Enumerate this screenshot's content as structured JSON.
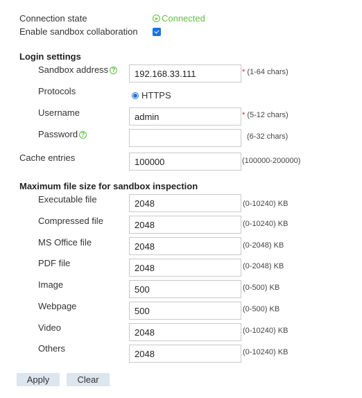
{
  "connection": {
    "label": "Connection state",
    "status": "Connected",
    "status_color": "#5fbf3e"
  },
  "collaboration": {
    "label": "Enable sandbox collaboration",
    "checked": true
  },
  "login": {
    "title": "Login settings",
    "address": {
      "label": "Sandbox address",
      "value": "192.168.33.111",
      "hint": "(1-64 chars)"
    },
    "protocols": {
      "label": "Protocols",
      "option": "HTTPS"
    },
    "username": {
      "label": "Username",
      "value": "admin",
      "hint": "(5-12 chars)"
    },
    "password": {
      "label": "Password",
      "value": "",
      "hint": "(6-32 chars)"
    }
  },
  "cache": {
    "label": "Cache entries",
    "value": "100000",
    "hint": "(100000-200000)"
  },
  "filesize": {
    "title": "Maximum file size for sandbox inspection",
    "items": [
      {
        "label": "Executable file",
        "value": "2048",
        "hint": "(0-10240) KB"
      },
      {
        "label": "Compressed file",
        "value": "2048",
        "hint": "(0-10240) KB"
      },
      {
        "label": "MS Office file",
        "value": "2048",
        "hint": "(0-2048) KB"
      },
      {
        "label": "PDF file",
        "value": "2048",
        "hint": "(0-2048) KB"
      },
      {
        "label": "Image",
        "value": "500",
        "hint": "(0-500) KB"
      },
      {
        "label": "Webpage",
        "value": "500",
        "hint": "(0-500) KB"
      },
      {
        "label": "Video",
        "value": "2048",
        "hint": "(0-10240) KB"
      },
      {
        "label": "Others",
        "value": "2048",
        "hint": "(0-10240) KB"
      }
    ]
  },
  "buttons": {
    "apply": "Apply",
    "clear": "Clear"
  },
  "icons": {
    "status": "play-circle-icon",
    "help": "help-icon",
    "required": "asterisk"
  },
  "colors": {
    "accent": "#1a73d9",
    "button_bg": "#dde5ee",
    "required": "#dd2222"
  }
}
